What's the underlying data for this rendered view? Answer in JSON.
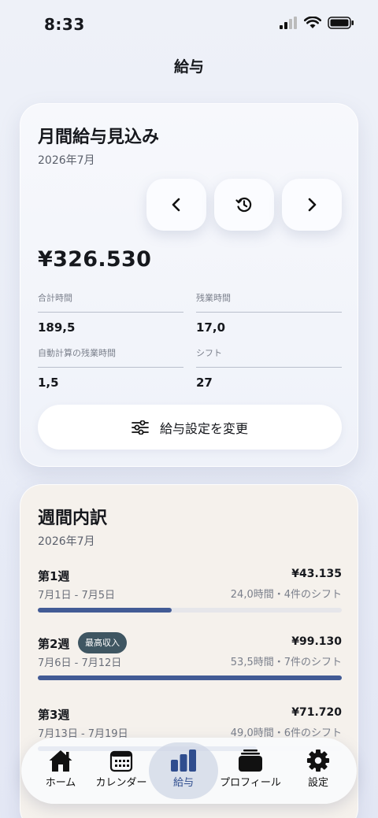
{
  "status": {
    "time": "8:33"
  },
  "nav": {
    "title": "給与"
  },
  "pay_card": {
    "title": "月間給与見込み",
    "month": "2026年7月",
    "amount": "¥326.530",
    "stats": [
      {
        "label": "合計時間",
        "value": "189,5"
      },
      {
        "label": "残業時間",
        "value": "17,0"
      },
      {
        "label": "自動計算の残業時間",
        "value": "1,5"
      },
      {
        "label": "シフト",
        "value": "27"
      }
    ],
    "settings_button": "給与設定を変更"
  },
  "weekly_card": {
    "title": "週間内訳",
    "month": "2026年7月",
    "weeks": [
      {
        "label": "第1週",
        "dates": "7月1日 - 7月5日",
        "amount": "¥43.135",
        "meta": "24,0時間・4件のシフト",
        "progress": 0.44
      },
      {
        "label": "第2週",
        "badge": "最高収入",
        "dates": "7月6日 - 7月12日",
        "amount": "¥99.130",
        "meta": "53,5時間・7件のシフト",
        "progress": 1.0
      },
      {
        "label": "第3週",
        "dates": "7月13日 - 7月19日",
        "amount": "¥71.720",
        "meta": "49,0時間・6件のシフト",
        "progress": 0.72
      }
    ]
  },
  "tab_bar": {
    "items": [
      {
        "label": "ホーム",
        "icon": "house-icon",
        "active": false
      },
      {
        "label": "カレンダー",
        "icon": "calendar-icon",
        "active": false
      },
      {
        "label": "給与",
        "icon": "bar-chart-icon",
        "active": true
      },
      {
        "label": "プロフィール",
        "icon": "card-stack-icon",
        "active": false
      },
      {
        "label": "設定",
        "icon": "gear-icon",
        "active": false
      }
    ]
  },
  "colors": {
    "accent": "#425b95",
    "badge": "#3f5662",
    "active_tab_label": "#2f4d8e"
  }
}
